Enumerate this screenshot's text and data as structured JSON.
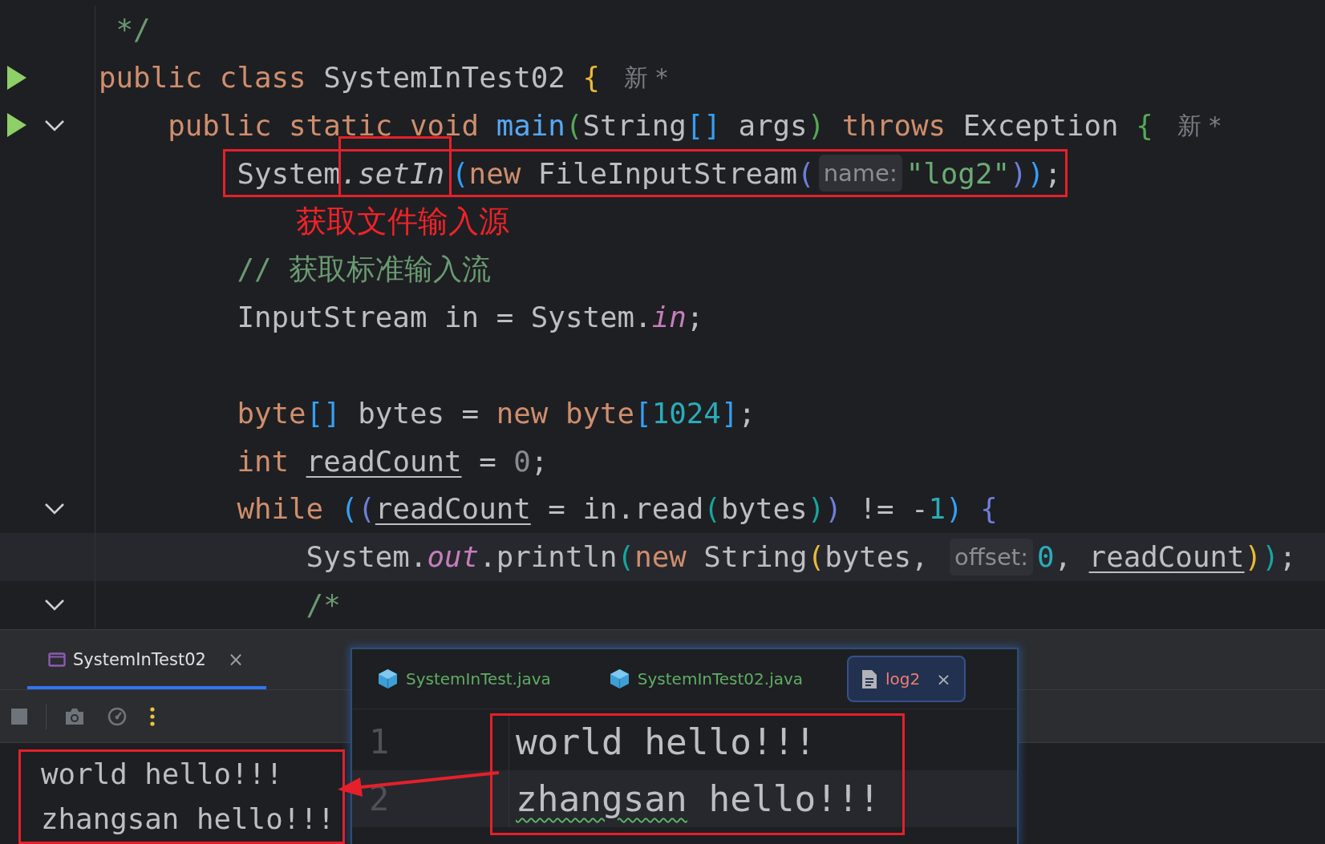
{
  "editor": {
    "lines": [
      {
        "run": false,
        "fold": false,
        "current": false,
        "boxed": false,
        "tokens": [
          {
            "kind": "cmt",
            "text": " */"
          }
        ]
      },
      {
        "run": true,
        "fold": false,
        "current": false,
        "boxed": false,
        "tokens": [
          {
            "kind": "kw",
            "text": "public class "
          },
          {
            "kind": "plain",
            "text": "SystemInTest02 "
          },
          {
            "kind": "b1",
            "text": "{"
          },
          {
            "kind": "author",
            "text": "新 *"
          }
        ],
        "children": [
          {
            "run": true,
            "fold": true,
            "current": false,
            "boxed": false,
            "tokens": [
              {
                "kind": "kw",
                "text": "public static void "
              },
              {
                "kind": "fn",
                "text": "main"
              },
              {
                "kind": "b2",
                "text": "("
              },
              {
                "kind": "plain",
                "text": "String"
              },
              {
                "kind": "b3",
                "text": "[]"
              },
              {
                "kind": "plain",
                "text": " args"
              },
              {
                "kind": "b2",
                "text": ")"
              },
              {
                "kind": "kw",
                "text": " throws "
              },
              {
                "kind": "plain",
                "text": "Exception "
              },
              {
                "kind": "b2",
                "text": "{"
              },
              {
                "kind": "author",
                "text": "新 *"
              }
            ],
            "children": [
              {
                "run": false,
                "fold": false,
                "current": false,
                "boxed": true,
                "tokens": [
                  {
                    "kind": "plain",
                    "text": "System"
                  },
                  {
                    "kind": "box",
                    "tokens": [
                      {
                        "kind": "call",
                        "text": ".setIn"
                      }
                    ]
                  },
                  {
                    "kind": "b3",
                    "text": "("
                  },
                  {
                    "kind": "kw",
                    "text": "new "
                  },
                  {
                    "kind": "plain",
                    "text": "FileInputStream"
                  },
                  {
                    "kind": "b4",
                    "text": "("
                  },
                  {
                    "kind": "hint",
                    "text": "name:"
                  },
                  {
                    "kind": "str",
                    "text": "\"log2\""
                  },
                  {
                    "kind": "b4",
                    "text": ")"
                  },
                  {
                    "kind": "b3",
                    "text": ")"
                  },
                  {
                    "kind": "plain",
                    "text": ";"
                  }
                ]
              },
              {
                "run": false,
                "fold": false,
                "current": false,
                "boxed": false,
                "note": "获取文件输入源"
              },
              {
                "run": false,
                "fold": false,
                "current": false,
                "boxed": false,
                "tokens": [
                  {
                    "kind": "cmt",
                    "text": "// 获取标准输入流"
                  }
                ]
              },
              {
                "run": false,
                "fold": false,
                "current": false,
                "boxed": false,
                "tokens": [
                  {
                    "kind": "plain",
                    "text": "InputStream in = System."
                  },
                  {
                    "kind": "field",
                    "text": "in"
                  },
                  {
                    "kind": "plain",
                    "text": ";"
                  }
                ]
              },
              {
                "run": false,
                "fold": false,
                "current": false,
                "boxed": false
              },
              {
                "run": false,
                "fold": false,
                "current": false,
                "boxed": false,
                "tokens": [
                  {
                    "kind": "kw",
                    "text": "byte"
                  },
                  {
                    "kind": "b3",
                    "text": "[]"
                  },
                  {
                    "kind": "plain",
                    "text": " bytes = "
                  },
                  {
                    "kind": "kw",
                    "text": "new byte"
                  },
                  {
                    "kind": "b3",
                    "text": "["
                  },
                  {
                    "kind": "num",
                    "text": "1024"
                  },
                  {
                    "kind": "b3",
                    "text": "]"
                  },
                  {
                    "kind": "plain",
                    "text": ";"
                  }
                ]
              },
              {
                "run": false,
                "fold": false,
                "current": false,
                "boxed": false,
                "tokens": [
                  {
                    "kind": "kw",
                    "text": "int "
                  },
                  {
                    "kind": "var",
                    "text": "readCount"
                  },
                  {
                    "kind": "plain",
                    "text": " = "
                  },
                  {
                    "kind": "zero",
                    "text": "0"
                  },
                  {
                    "kind": "plain",
                    "text": ";"
                  }
                ]
              },
              {
                "run": false,
                "fold": true,
                "current": false,
                "boxed": false,
                "tokens": [
                  {
                    "kind": "kw",
                    "text": "while "
                  },
                  {
                    "kind": "b3",
                    "text": "("
                  },
                  {
                    "kind": "b4",
                    "text": "("
                  },
                  {
                    "kind": "var",
                    "text": "readCount"
                  },
                  {
                    "kind": "plain",
                    "text": " = in.read"
                  },
                  {
                    "kind": "b5",
                    "text": "("
                  },
                  {
                    "kind": "plain",
                    "text": "bytes"
                  },
                  {
                    "kind": "b5",
                    "text": ")"
                  },
                  {
                    "kind": "b4",
                    "text": ")"
                  },
                  {
                    "kind": "plain",
                    "text": " != -"
                  },
                  {
                    "kind": "num",
                    "text": "1"
                  },
                  {
                    "kind": "b3",
                    "text": ")"
                  },
                  {
                    "kind": "b4",
                    "text": " {"
                  }
                ],
                "children": [
                  {
                    "run": false,
                    "fold": false,
                    "current": true,
                    "boxed": false,
                    "tokens": [
                      {
                        "kind": "plain",
                        "text": "System."
                      },
                      {
                        "kind": "field",
                        "text": "out"
                      },
                      {
                        "kind": "plain",
                        "text": ".println"
                      },
                      {
                        "kind": "b5",
                        "text": "("
                      },
                      {
                        "kind": "kw",
                        "text": "new "
                      },
                      {
                        "kind": "plain",
                        "text": "String"
                      },
                      {
                        "kind": "b1",
                        "text": "("
                      },
                      {
                        "kind": "plain",
                        "text": "bytes, "
                      },
                      {
                        "kind": "hint",
                        "text": "offset:"
                      },
                      {
                        "kind": "num",
                        "text": "0"
                      },
                      {
                        "kind": "plain",
                        "text": ", "
                      },
                      {
                        "kind": "var",
                        "text": "readCount"
                      },
                      {
                        "kind": "b1",
                        "text": ")"
                      },
                      {
                        "kind": "b5",
                        "text": ")"
                      },
                      {
                        "kind": "plain",
                        "text": ";"
                      }
                    ]
                  },
                  {
                    "run": false,
                    "fold": true,
                    "current": false,
                    "boxed": false,
                    "tokens": [
                      {
                        "kind": "cmt",
                        "text": "/*"
                      }
                    ]
                  }
                ]
              }
            ]
          }
        ]
      }
    ]
  },
  "run_panel": {
    "tab": {
      "label": "SystemInTest02",
      "selected": true,
      "close": "×"
    },
    "boxed": true,
    "output": [
      "world hello!!!",
      "zhangsan hello!!!"
    ]
  },
  "preview": {
    "tabs": [
      {
        "label": "SystemInTest.java",
        "kind": "java",
        "selected": false,
        "color": "#5fad65"
      },
      {
        "label": "SystemInTest02.java",
        "kind": "java",
        "selected": false,
        "color": "#5fad65"
      },
      {
        "label": "log2",
        "kind": "text",
        "selected": true,
        "color": "#f07f70",
        "close": "×"
      }
    ],
    "boxed": true,
    "lines": [
      {
        "number": "1",
        "current": false,
        "tokens": [
          {
            "text": "world hello!!!",
            "typo": false
          }
        ]
      },
      {
        "number": "2",
        "current": true,
        "tokens": [
          {
            "text": "zhangsan",
            "typo": true
          },
          {
            "text": " hello!!!",
            "typo": false
          }
        ]
      }
    ]
  }
}
